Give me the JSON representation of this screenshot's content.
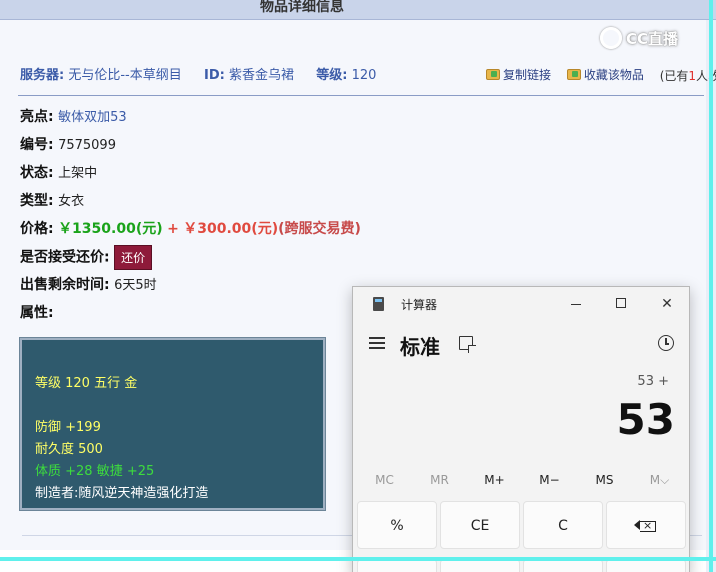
{
  "header": {
    "title": "物品详细信息"
  },
  "logo": {
    "text": "CC直播"
  },
  "info": {
    "server_label": "服务器:",
    "server_value": "无与伦比--本草纲目",
    "id_label": "ID:",
    "id_value": "紫香金乌裙",
    "level_label": "等级:",
    "level_value": "120"
  },
  "actions": {
    "copy_link": "复制链接",
    "favorite": "收藏该物品",
    "owned_prefix": "(已有",
    "owned_count": "1",
    "owned_suffix": "人收"
  },
  "fields": {
    "highlight_label": "亮点:",
    "highlight_value": "敏体双加53",
    "serial_label": "编号:",
    "serial_value": "7575099",
    "status_label": "状态:",
    "status_value": "上架中",
    "type_label": "类型:",
    "type_value": "女衣",
    "price_label": "价格:",
    "price_value": "￥1350.00(元)",
    "price_plus": "+",
    "fee_value": "￥300.00(元)",
    "fee_note": "(跨服交易费)",
    "bargain_label": "是否接受还价:",
    "bargain_button": "还价",
    "time_label": "出售剩余时间:",
    "time_value": "6天5时",
    "attr_label": "属性:"
  },
  "attributes": {
    "line1": "等级 120 五行 金",
    "line2": "防御 +199",
    "line3": "耐久度 500",
    "line4": "体质 +28 敏捷 +25",
    "line5": "制造者:随风逆天神造强化打造"
  },
  "calculator": {
    "window_title": "计算器",
    "mode": "标准",
    "expression": "53 +",
    "display": "53",
    "memory": [
      "MC",
      "MR",
      "M+",
      "M−",
      "MS",
      "M⌵"
    ],
    "keys": {
      "percent": "%",
      "ce": "CE",
      "c": "C"
    }
  }
}
